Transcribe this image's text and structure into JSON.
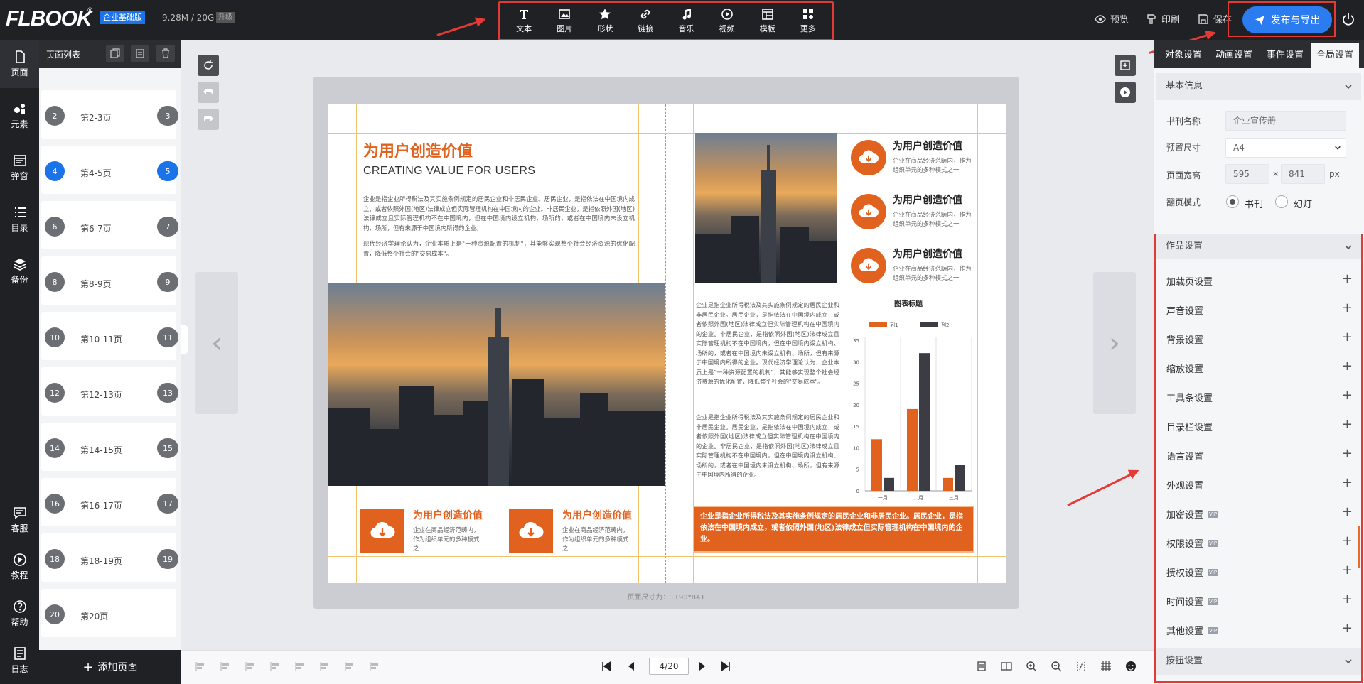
{
  "brand": {
    "logo": "FLBOOK",
    "edition": "企业基础版",
    "storage": "9.28M / 20G",
    "upgrade": "升级"
  },
  "toolbar": [
    "文本",
    "图片",
    "形状",
    "链接",
    "音乐",
    "视频",
    "模板",
    "更多"
  ],
  "top_actions": {
    "preview": "预览",
    "print": "印刷",
    "save": "保存",
    "publish": "发布与导出"
  },
  "leftnav": [
    "页面",
    "元素",
    "弹窗",
    "目录",
    "备份",
    "客服",
    "教程",
    "帮助",
    "日志"
  ],
  "pagelist": {
    "title": "页面列表",
    "add_page": "添加页面",
    "rows": [
      {
        "left": "2",
        "label": "第2-3页",
        "right": "3",
        "active": false
      },
      {
        "left": "4",
        "label": "第4-5页",
        "right": "5",
        "active": true
      },
      {
        "left": "6",
        "label": "第6-7页",
        "right": "7",
        "active": false
      },
      {
        "left": "8",
        "label": "第8-9页",
        "right": "9",
        "active": false
      },
      {
        "left": "10",
        "label": "第10-11页",
        "right": "11",
        "active": false
      },
      {
        "left": "12",
        "label": "第12-13页",
        "right": "13",
        "active": false
      },
      {
        "left": "14",
        "label": "第14-15页",
        "right": "15",
        "active": false
      },
      {
        "left": "16",
        "label": "第16-17页",
        "right": "17",
        "active": false
      },
      {
        "left": "18",
        "label": "第18-19页",
        "right": "19",
        "active": false
      },
      {
        "left": "20",
        "label": "第20页",
        "right": "",
        "active": false
      }
    ]
  },
  "book": {
    "page_size": "页面尺寸为：1190*841",
    "left_title": "为用户创造价值",
    "left_subtitle": "CREATING VALUE FOR USERS",
    "left_para1": "企业是指企业所得税法及其实施条例规定的居民企业和非居民企业。居民企业，是指依法在中国境内成立，或者依照外国(地区)法律成立但实际管理机构在中国境内的企业。非居民企业，是指依照外国(地区)法律成立且实际管理机构不在中国境内，但在中国境内设立机构、场所的，或者在中国境内未设立机构、场所，但有来源于中国境内所得的企业。",
    "left_para2": "现代经济学理论认为，企业本质上是\"一种资源配置的机制\"，其能够实现整个社会经济资源的优化配置，降低整个社会的\"交易成本\"。",
    "feature_title": "为用户创造价值",
    "feature_text": "企业在商品经济范畴内，作为组织单元的多种模式之一",
    "right_para": "企业是指企业所得税法及其实施条例规定的居民企业和非居民企业。居民企业，是指依法在中国境内成立，或者依照外国(地区)法律成立但实际管理机构在中国境内的企业。非居民企业，是指依照外国(地区)法律成立且实际管理机构不在中国境内，但在中国境内设立机构、场所的，或者在中国境内未设立机构、场所，但有来源于中国境内所得的企业。现代经济学理论认为，企业本质上是\"一种资源配置的机制\"，其能够实现整个社会经济资源的优化配置，降低整个社会的\"交易成本\"。",
    "right_para2": "企业是指企业所得税法及其实施条例规定的居民企业和非居民企业。居民企业，是指依法在中国境内成立，或者依照外国(地区)法律成立但实际管理机构在中国境内的企业。非居民企业，是指依照外国(地区)法律成立且实际管理机构不在中国境内，但在中国境内设立机构、场所的，或者在中国境内未设立机构、场所，但有来源于中国境内所得的企业。",
    "highlight": "企业是指企业所得税法及其实施条例规定的居民企业和非居民企业。居民企业，是指依法在中国境内成立，或者依照外国(地区)法律成立但实际管理机构在中国境内的企业。",
    "accent_color": "#e0621e"
  },
  "chart_data": {
    "type": "bar",
    "title": "图表标题",
    "categories": [
      "一月",
      "二月",
      "三月"
    ],
    "series": [
      {
        "name": "列1",
        "values": [
          12,
          19,
          3
        ],
        "color": "#e0621e"
      },
      {
        "name": "列2",
        "values": [
          3,
          32,
          6
        ],
        "color": "#3c3d44"
      }
    ],
    "ylim": [
      0,
      35
    ],
    "yticks": [
      "0",
      "5",
      "10",
      "15",
      "20",
      "25",
      "30",
      "35"
    ],
    "legend": "top"
  },
  "rpanel": {
    "tabs": [
      "对象设置",
      "动画设置",
      "事件设置",
      "全局设置"
    ],
    "basic_info": "基本信息",
    "book_name_label": "书刊名称",
    "book_name_value": "企业宣传册",
    "preset_label": "预置尺寸",
    "preset_value": "A4",
    "size_label": "页面宽高",
    "width": "595",
    "times": "×",
    "height": "841",
    "unit": "px",
    "flip_label": "翻页模式",
    "flip_book": "书刊",
    "flip_slide": "幻灯",
    "work_settings": "作品设置",
    "settings": [
      {
        "label": "加载页设置",
        "vip": false
      },
      {
        "label": "声音设置",
        "vip": false
      },
      {
        "label": "背景设置",
        "vip": false
      },
      {
        "label": "缩放设置",
        "vip": false
      },
      {
        "label": "工具条设置",
        "vip": false
      },
      {
        "label": "目录栏设置",
        "vip": false
      },
      {
        "label": "语言设置",
        "vip": false
      },
      {
        "label": "外观设置",
        "vip": false
      },
      {
        "label": "加密设置",
        "vip": true
      },
      {
        "label": "权限设置",
        "vip": true
      },
      {
        "label": "授权设置",
        "vip": true
      },
      {
        "label": "时间设置",
        "vip": true
      },
      {
        "label": "其他设置",
        "vip": true
      }
    ],
    "vip_tag": "VIP",
    "button_settings": "按钮设置"
  },
  "bottom": {
    "page": "4/20"
  }
}
